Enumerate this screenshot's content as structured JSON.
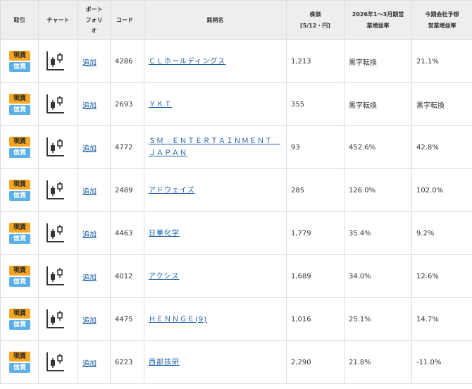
{
  "headers": {
    "trade": "取引",
    "chart": "チャート",
    "portfolio_l1": "ポート",
    "portfolio_l2": "フォリ",
    "portfolio_l3": "オ",
    "code": "コード",
    "name": "銘柄名",
    "price_l1": "株価",
    "price_l2": "[5/12・円]",
    "growth_l1": "2026年1～3月期営",
    "growth_l2": "業増益率",
    "forecast_l1": "今期会社予想",
    "forecast_l2": "営業増益率"
  },
  "badges": {
    "genbutsu": "現買",
    "shinyo": "信買"
  },
  "icons": {
    "chart": "candlestick-chart-icon"
  },
  "colors": {
    "genbutsu": "#f5a623",
    "shinyo": "#5cb0e8",
    "link": "#1a5ea8",
    "header_bg": "#eeeeee"
  },
  "rows": [
    {
      "add": "追加",
      "code": "4286",
      "name": "ＣＬホールディングス",
      "price": "1,213",
      "growth": "黒字転換",
      "forecast": "21.1%"
    },
    {
      "add": "追加",
      "code": "2693",
      "name": "ＹＫＴ",
      "price": "355",
      "growth": "黒字転換",
      "forecast": "黒字転換"
    },
    {
      "add": "追加",
      "code": "4772",
      "name": "ＳＭ　ＥＮＴＥＲＴＡＩＮＭＥＮＴ　ＪＡＰＡＮ",
      "price": "93",
      "growth": "452.6%",
      "forecast": "42.8%"
    },
    {
      "add": "追加",
      "code": "2489",
      "name": "アドウェイズ",
      "price": "285",
      "growth": "126.0%",
      "forecast": "102.0%"
    },
    {
      "add": "追加",
      "code": "4463",
      "name": "日華化学",
      "price": "1,779",
      "growth": "35.4%",
      "forecast": "9.2%"
    },
    {
      "add": "追加",
      "code": "4012",
      "name": "アクシス",
      "price": "1,689",
      "growth": "34.0%",
      "forecast": "12.6%"
    },
    {
      "add": "追加",
      "code": "4475",
      "name": "ＨＥＮＮＧＥ(9)",
      "price": "1,016",
      "growth": "25.1%",
      "forecast": "14.7%"
    },
    {
      "add": "追加",
      "code": "6223",
      "name": "西部技研",
      "price": "2,290",
      "growth": "21.8%",
      "forecast": "-11.0%"
    }
  ]
}
